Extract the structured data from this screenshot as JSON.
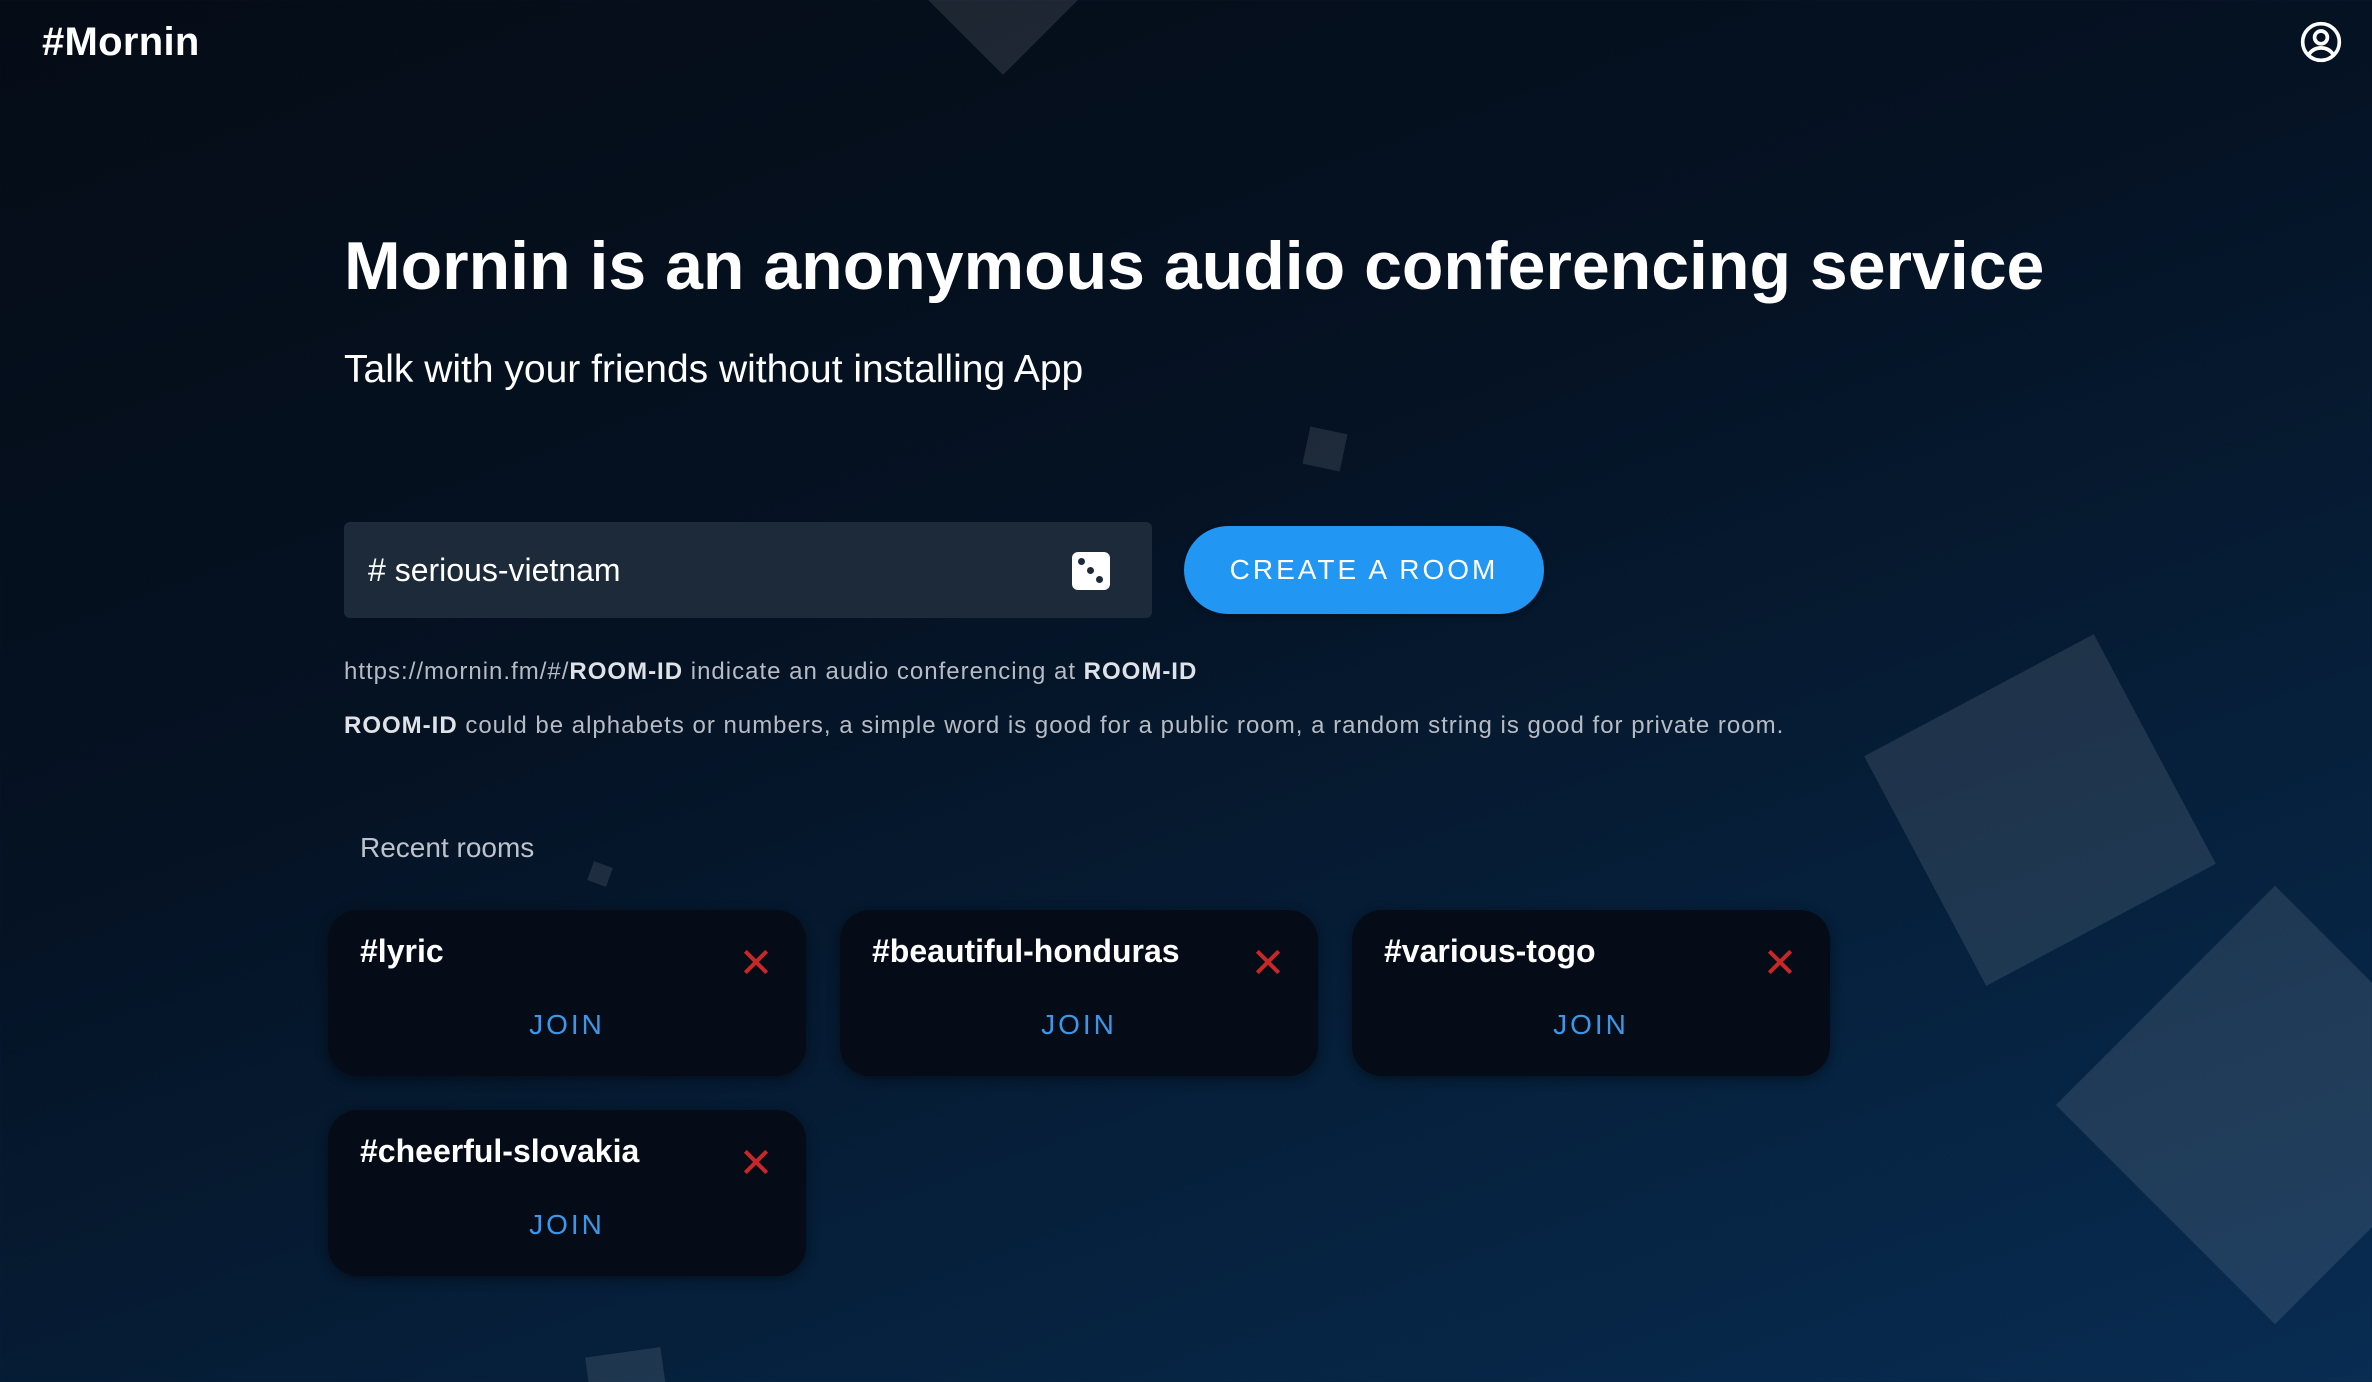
{
  "app": {
    "logo": "#Mornin"
  },
  "hero": {
    "title": "Mornin is an anonymous audio conferencing service",
    "subtitle": "Talk with your friends without installing App"
  },
  "create_room": {
    "input_value": "# serious-vietnam",
    "button_label": "CREATE A ROOM"
  },
  "hints": {
    "line1": {
      "url_prefix": "https://mornin.fm/#/",
      "room_id": "ROOM-ID",
      "middle": " indicate an audio conferencing at ",
      "room_id_end": "ROOM-ID"
    },
    "line2": {
      "room_id": "ROOM-ID",
      "rest": " could be alphabets or numbers, a simple word is good for a public room, a random string is good for private room."
    }
  },
  "recent": {
    "label": "Recent rooms",
    "rooms": [
      {
        "name": "#lyric",
        "join_label": "JOIN"
      },
      {
        "name": "#beautiful-honduras",
        "join_label": "JOIN"
      },
      {
        "name": "#various-togo",
        "join_label": "JOIN"
      },
      {
        "name": "#cheerful-slovakia",
        "join_label": "JOIN"
      }
    ]
  },
  "colors": {
    "accent": "#2196f3",
    "join_text": "#3b97e8",
    "remove_icon": "#c62828",
    "card_bg": "#050c18"
  },
  "icons": {
    "account": "account-circle-icon",
    "random": "dice-icon",
    "remove": "close-icon"
  }
}
